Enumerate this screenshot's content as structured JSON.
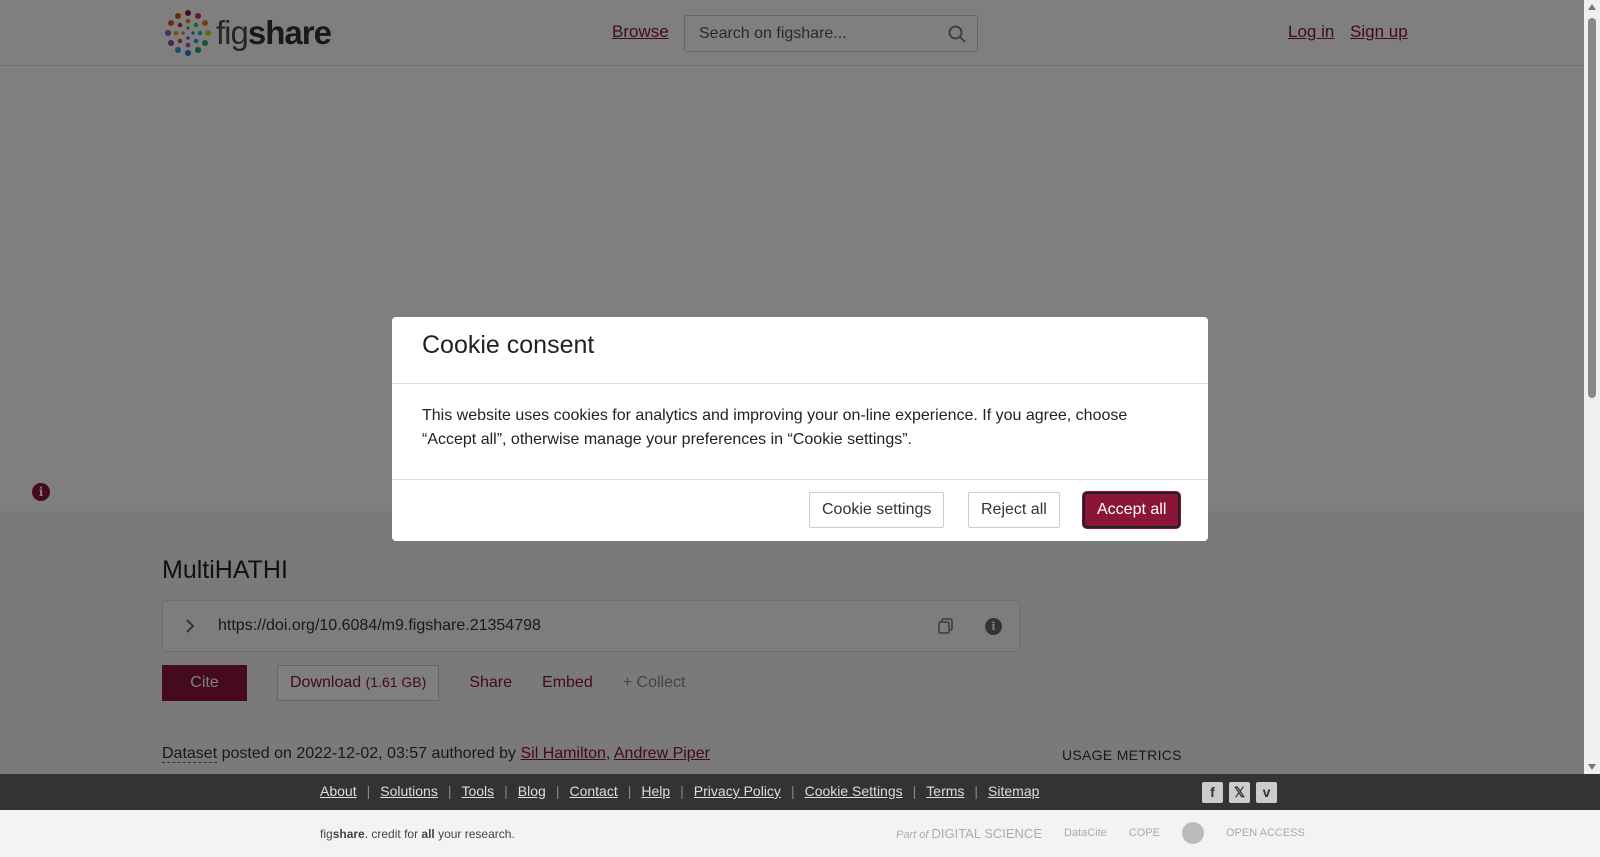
{
  "header": {
    "logo": {
      "prefix": "fig",
      "suffix": "share"
    },
    "browse": "Browse",
    "search_placeholder": "Search on figshare...",
    "login": "Log in",
    "signup": "Sign up"
  },
  "item": {
    "title": "MultiHATHI",
    "doi": "https://doi.org/10.6084/m9.figshare.21354798",
    "actions": {
      "cite": "Cite",
      "download": "Download",
      "download_size": "(1.61 GB)",
      "share": "Share",
      "embed": "Embed",
      "collect": "+ Collect"
    },
    "meta": {
      "type": "Dataset",
      "posted": "posted on 2022-12-02, 03:57 authored by",
      "author1": "Sil Hamilton",
      "comma": ",",
      "author2": "Andrew Piper"
    },
    "usage_metrics": "USAGE METRICS"
  },
  "modal": {
    "title": "Cookie consent",
    "body": "This website uses cookies for analytics and improving your on-line experience. If you agree, choose “Accept all”, otherwise manage your preferences in “Cookie settings”.",
    "settings": "Cookie settings",
    "reject": "Reject all",
    "accept": "Accept all"
  },
  "footer": {
    "links": [
      "About",
      "Solutions",
      "Tools",
      "Blog",
      "Contact",
      "Help",
      "Privacy Policy",
      "Cookie Settings",
      "Terms",
      "Sitemap"
    ],
    "social": [
      "facebook-icon",
      "x-icon",
      "vimeo-icon"
    ],
    "credit": {
      "fig": "fig",
      "share": "share",
      "mid": ". credit for ",
      "all": "all",
      "end": " your research."
    },
    "partners": {
      "ds_prefix": "Part of",
      "ds": "DIGITAL SCIENCE",
      "datacite": "DataCite",
      "cope": "COPE",
      "oa": "OPEN ACCESS"
    }
  },
  "colors": {
    "brand": "#8a1538"
  }
}
